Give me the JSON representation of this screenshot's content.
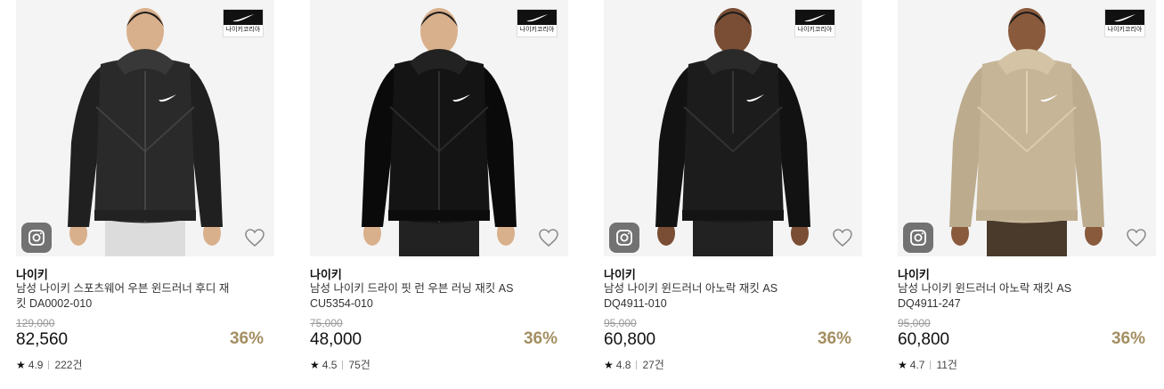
{
  "products": [
    {
      "brand_badge": "나이키코리아",
      "brand": "나이키",
      "name_line1": "남성 나이키 스포츠웨어 우븐 윈드러너 후디 재",
      "name_line2": "킷 DA0002-010",
      "original_price": "129,000",
      "price": "82,560",
      "discount": "36%",
      "rating": "4.9",
      "reviews": "222건",
      "jacket_color": "#2a2a2a",
      "has_instagram": true
    },
    {
      "brand_badge": "나이키코리아",
      "brand": "나이키",
      "name_line1": "남성 나이키 드라이 핏 런 우븐 러닝 재킷 AS",
      "name_line2": "CU5354-010",
      "original_price": "75,000",
      "price": "48,000",
      "discount": "36%",
      "rating": "4.5",
      "reviews": "75건",
      "jacket_color": "#141414",
      "has_instagram": false
    },
    {
      "brand_badge": "나이키코리아",
      "brand": "나이키",
      "name_line1": "남성 나이키 윈드러너 아노락 재킷 AS",
      "name_line2": "DQ4911-010",
      "original_price": "95,000",
      "price": "60,800",
      "discount": "36%",
      "rating": "4.8",
      "reviews": "27건",
      "jacket_color": "#1c1c1c",
      "has_instagram": true
    },
    {
      "brand_badge": "나이키코리아",
      "brand": "나이키",
      "name_line1": "남성 나이키 윈드러너 아노락 재킷 AS",
      "name_line2": "DQ4911-247",
      "original_price": "95,000",
      "price": "60,800",
      "discount": "36%",
      "rating": "4.7",
      "reviews": "11건",
      "jacket_color": "#c6b597",
      "has_instagram": true
    }
  ],
  "colors": {
    "discount": "#a48f62",
    "thumb_bg": "#f4f4f4"
  }
}
